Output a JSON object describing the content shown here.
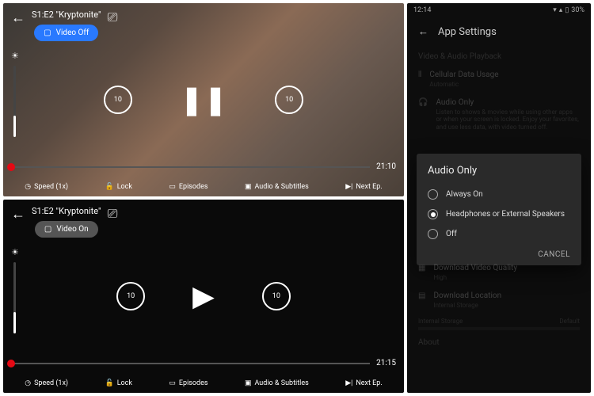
{
  "player_top": {
    "title": "S1:E2 \"Kryptonite\"",
    "pill_label": "Video Off",
    "skip_back": "10",
    "skip_fwd": "10",
    "duration": "21:10",
    "bottom": {
      "speed": "Speed (1x)",
      "lock": "Lock",
      "episodes": "Episodes",
      "audio": "Audio & Subtitles",
      "next": "Next Ep."
    }
  },
  "player_bottom": {
    "title": "S1:E2 \"Kryptonite\"",
    "pill_label": "Video On",
    "skip_back": "10",
    "skip_fwd": "10",
    "duration": "21:15",
    "bottom": {
      "speed": "Speed (1x)",
      "lock": "Lock",
      "episodes": "Episodes",
      "audio": "Audio & Subtitles",
      "next": "Next Ep."
    }
  },
  "settings": {
    "status_time": "12:14",
    "battery": "30%",
    "title": "App Settings",
    "section1": {
      "header": "Video & Audio Playback",
      "row1": {
        "title": "Cellular Data Usage",
        "sub": "Automatic"
      },
      "row2": {
        "title": "Audio Only",
        "sub": "Listen to shows & movies while using other apps or when your screen is locked. Enjoy your favorites, and use less data, with video turned off."
      }
    },
    "dialog": {
      "title": "Audio Only",
      "opt1": "Always On",
      "opt2": "Headphones or External Speakers",
      "opt3": "Off",
      "cancel": "CANCEL"
    },
    "row_dq": {
      "title": "Download Video Quality",
      "sub": "High"
    },
    "row_dl": {
      "title": "Download Location",
      "sub": "Internal Storage"
    },
    "storage_label": "Internal Storage",
    "storage_default": "Default",
    "about": "About"
  }
}
